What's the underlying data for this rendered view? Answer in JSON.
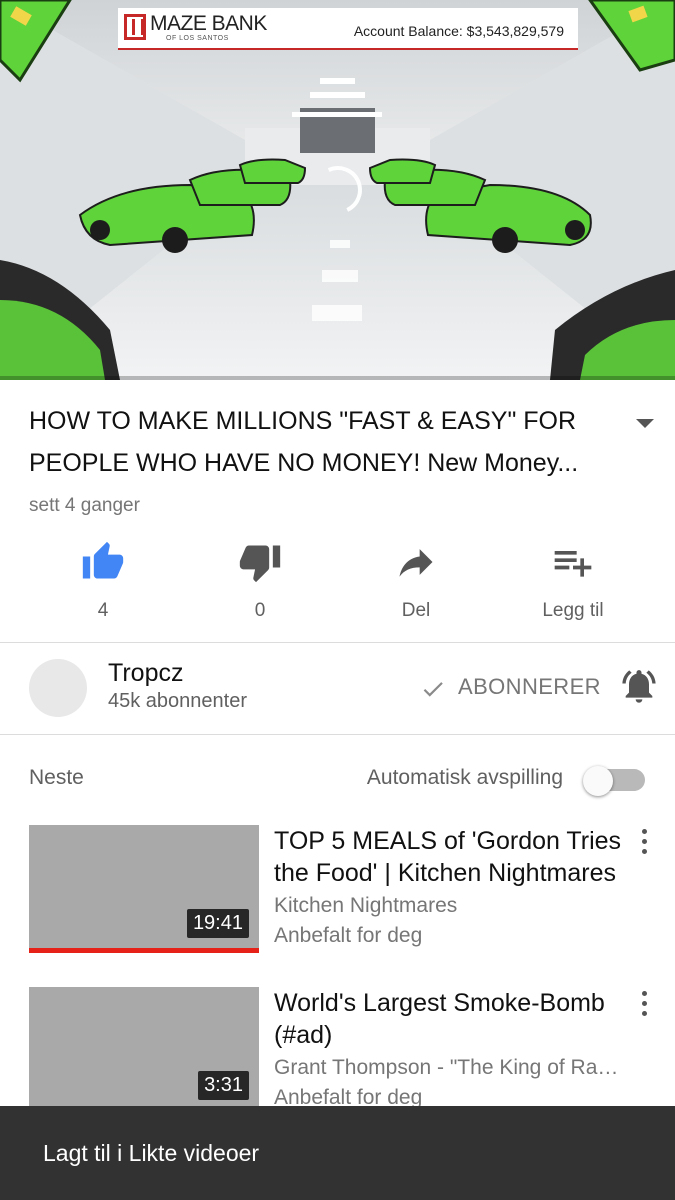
{
  "player": {
    "overlay": {
      "bank_name": "MAZE BANK",
      "bank_subtitle": "OF LOS SANTOS",
      "balance_text": "Account Balance: $3,543,829,579"
    },
    "progress_fraction": 0.0,
    "colors": {
      "progress": "#e62117",
      "car": "#5fd33a",
      "banner_accent": "#c62828"
    }
  },
  "video": {
    "title": "HOW TO MAKE MILLIONS \"FAST & EASY\" FOR PEOPLE WHO HAVE NO MONEY! New Money...",
    "views": "sett 4 ganger"
  },
  "actions": {
    "like": {
      "icon": "thumbs-up-icon",
      "label": "4",
      "active": true,
      "color": "#4285f4"
    },
    "dislike": {
      "icon": "thumbs-down-icon",
      "label": "0"
    },
    "share": {
      "icon": "share-arrow-icon",
      "label": "Del"
    },
    "add": {
      "icon": "playlist-add-icon",
      "label": "Legg til"
    }
  },
  "channel": {
    "name": "Tropcz",
    "subscribers": "45k abonnenter",
    "subscribe_label": "ABONNERER",
    "notification_icon": "bell-icon"
  },
  "up_next": {
    "heading": "Neste",
    "autoplay_label": "Automatisk avspilling",
    "autoplay_on": false,
    "videos": [
      {
        "title": "TOP 5 MEALS of 'Gordon Tries the Food' | Kitchen Nightmares",
        "channel": "Kitchen Nightmares",
        "reason": "Anbefalt for deg",
        "duration": "19:41",
        "watched_fraction": 1.0
      },
      {
        "title": "World's Largest Smoke-Bomb (#ad)",
        "channel": "Grant Thompson - \"The King of Random\"",
        "reason": "Anbefalt for deg",
        "duration": "3:31",
        "watched_fraction": 0.0
      }
    ]
  },
  "snackbar": {
    "message": "Lagt til i Likte videoer"
  }
}
